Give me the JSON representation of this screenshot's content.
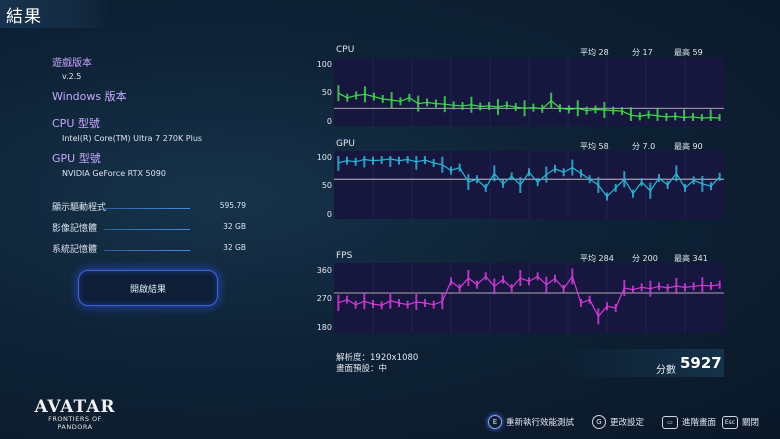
{
  "header": {
    "title": "結果"
  },
  "game_info": {
    "version_label": "遊戲版本",
    "version_value": "v.2.5",
    "platform_label": "Windows 版本",
    "cpu_label": "CPU 型號",
    "cpu_value": "Intel(R) Core(TM) Ultra 7 270K Plus",
    "gpu_label": "GPU 型號",
    "gpu_value": "NVIDIA GeForce RTX 5090"
  },
  "stats": [
    {
      "label": "顯示驅動程式",
      "value": "595.79"
    },
    {
      "label": "影像記憶體",
      "value": "32 GB"
    },
    {
      "label": "系統記憶體",
      "value": "32 GB"
    }
  ],
  "open_results_label": "開啟結果",
  "charts": {
    "cpu": {
      "title": "CPU",
      "avg_label": "平均",
      "avg": "28",
      "score_label": "分",
      "score": "17",
      "peak_label": "最高",
      "peak": "59",
      "ticks": [
        "100",
        "50",
        "0"
      ],
      "color": "#3ddc4a"
    },
    "gpu": {
      "title": "GPU",
      "avg_label": "平均",
      "avg": "58",
      "score_label": "分",
      "score": "7.0",
      "peak_label": "最高",
      "peak": "90",
      "ticks": [
        "100",
        "50",
        "0"
      ],
      "color": "#27b8d8"
    },
    "fps": {
      "title": "FPS",
      "avg_label": "平均",
      "avg": "284",
      "score_label": "分",
      "score": "200",
      "peak_label": "最高",
      "peak": "341",
      "ticks": [
        "360",
        "270",
        "180"
      ],
      "color": "#d23bd8"
    }
  },
  "chart_data": [
    {
      "type": "line",
      "title": "CPU",
      "ylim": [
        0,
        100
      ],
      "reference_line": 22,
      "series": [
        {
          "values": [
            48,
            40,
            44,
            46,
            42,
            38,
            36,
            34,
            40,
            30,
            32,
            30,
            29,
            27,
            26,
            28,
            25,
            26,
            24,
            27,
            24,
            22,
            23,
            21,
            35,
            22,
            20,
            22,
            18,
            20,
            19,
            18,
            17,
            10,
            8,
            11,
            9,
            7,
            8,
            6,
            7,
            5,
            6,
            5
          ]
        }
      ]
    },
    {
      "type": "line",
      "title": "GPU",
      "ylim": [
        0,
        100
      ],
      "reference_line": 60,
      "series": [
        {
          "values": [
            88,
            92,
            90,
            94,
            92,
            93,
            95,
            92,
            94,
            90,
            93,
            88,
            85,
            75,
            80,
            55,
            60,
            45,
            70,
            52,
            65,
            50,
            72,
            55,
            68,
            78,
            72,
            80,
            70,
            60,
            50,
            30,
            45,
            60,
            35,
            55,
            40,
            62,
            50,
            70,
            45,
            58,
            52,
            48,
            64
          ]
        }
      ]
    },
    {
      "type": "line",
      "title": "FPS",
      "ylim": [
        180,
        360
      ],
      "reference_line": 285,
      "series": [
        {
          "values": [
            255,
            265,
            250,
            260,
            252,
            248,
            262,
            255,
            250,
            258,
            255,
            250,
            260,
            320,
            300,
            330,
            310,
            335,
            305,
            325,
            300,
            330,
            320,
            335,
            310,
            328,
            298,
            335,
            255,
            265,
            215,
            245,
            240,
            300,
            295,
            302,
            298,
            305,
            300,
            306,
            302,
            305,
            308,
            306,
            310
          ]
        }
      ]
    }
  ],
  "settings": {
    "resolution_label": "解析度：",
    "resolution": "1920x1080",
    "preset_label": "畫面預設：",
    "preset": "中"
  },
  "score": {
    "label": "分數",
    "value": "5927"
  },
  "logo": {
    "line1": "AVATAR",
    "line2": "FRONTIERS OF PANDORA"
  },
  "footer": [
    {
      "key": "E",
      "label": "重新執行效能測試"
    },
    {
      "key": "G",
      "label": "更改設定"
    },
    {
      "key": "",
      "label": "進階畫面"
    },
    {
      "key": "Esc",
      "label": "關閉"
    }
  ]
}
